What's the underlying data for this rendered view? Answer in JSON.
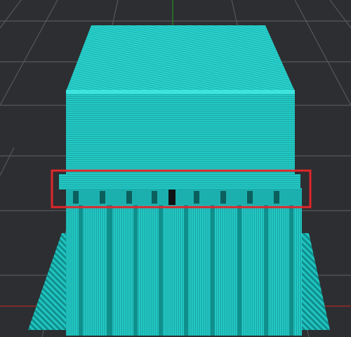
{
  "viewport": {
    "view": "3d-slicer-layer-preview",
    "background_color": "#2d2e31",
    "grid_color": "#55575b",
    "axis_x_color": "#9a2a2a",
    "axis_y_color": "#2a7a2a",
    "model_color": "#21c4c1",
    "model_shade_color": "#0f8f8c",
    "highlight_color": "#e0262b",
    "model_top_label": "",
    "highlight_note": ""
  }
}
